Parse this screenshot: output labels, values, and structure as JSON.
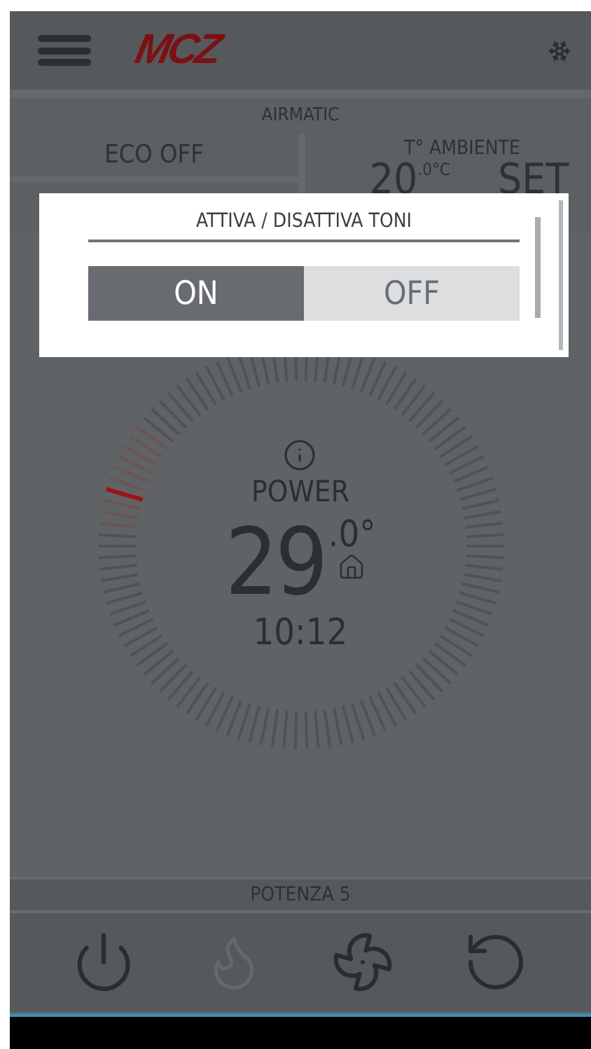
{
  "header": {
    "logo": "MCZ"
  },
  "airmatic": {
    "title": "AIRMATIC",
    "eco": "ECO OFF",
    "ambient_label": "T° AMBIENTE",
    "ambient_value": "20",
    "ambient_decimal": ".0°C",
    "set_label": "SET"
  },
  "dialog": {
    "title": "ATTIVA / DISATTIVA TONI",
    "options": [
      {
        "label": "ON",
        "selected": true
      },
      {
        "label": "OFF",
        "selected": false
      }
    ]
  },
  "dial": {
    "mode": "POWER",
    "temperature": "29",
    "decimal": ".0°",
    "time": "10:12"
  },
  "power_bar": {
    "label": "POTENZA 5"
  },
  "toolbar": [
    {
      "kind": "power",
      "disabled": false
    },
    {
      "kind": "flame",
      "disabled": true
    },
    {
      "kind": "fan",
      "disabled": false
    },
    {
      "kind": "reset",
      "disabled": false
    }
  ]
}
